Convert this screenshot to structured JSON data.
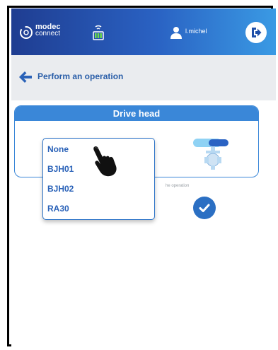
{
  "app": {
    "logo_line1": "modec",
    "logo_line2": "connect",
    "username": "l.michel"
  },
  "subheader": {
    "title": "Perform an operation"
  },
  "card": {
    "title": "Drive head"
  },
  "hint": "he operation",
  "dropdown": {
    "options": [
      "None",
      "BJH01",
      "BJH02",
      "RA30"
    ]
  },
  "icons": {
    "brand": "modec-logo-icon",
    "battery": "battery-wifi-icon",
    "user": "user-icon",
    "logout": "logout-icon",
    "back": "arrow-left-icon",
    "valve": "drive-head-valve-icon",
    "confirm": "check-icon",
    "cursor": "hand-pointer-icon"
  },
  "colors": {
    "primary": "#2a62c3",
    "accent": "#3a87d8",
    "subheader_bg": "#eaecef"
  }
}
